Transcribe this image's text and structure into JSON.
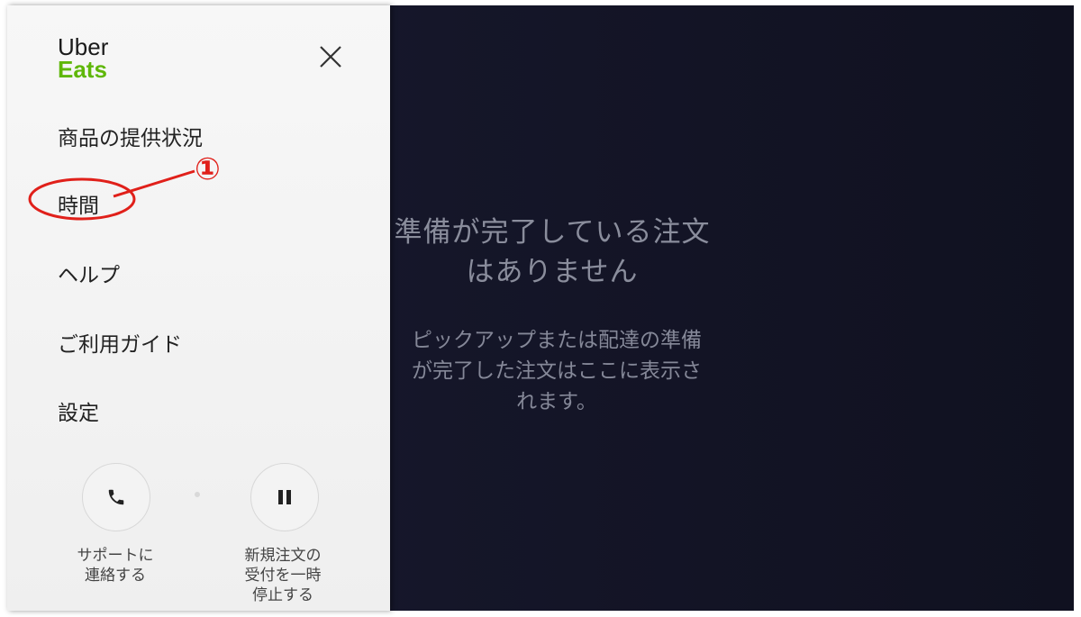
{
  "logo": {
    "line1": "Uber",
    "line2": "Eats"
  },
  "drawer": {
    "close_icon": "close-icon",
    "menu": [
      {
        "label": "商品の提供状況"
      },
      {
        "label": "時間"
      },
      {
        "label": "ヘルプ"
      },
      {
        "label": "ご利用ガイド"
      },
      {
        "label": "設定"
      }
    ],
    "annotation": {
      "label": "①",
      "color": "#e0201a"
    },
    "actions": [
      {
        "icon": "phone-icon",
        "caption": "サポートに\n連絡する"
      },
      {
        "icon": "pause-icon",
        "caption": "新規注文の\n受付を一時\n停止する"
      }
    ]
  },
  "main": {
    "empty_title": "準備が完了している注文\nはありません",
    "empty_description": "ピックアップまたは配達の準備\nが完了した注文はここに表示さ\nれます。"
  },
  "colors": {
    "brand_green": "#5fb709",
    "background_dark": "#141528",
    "drawer_bg": "#f7f7f7"
  }
}
